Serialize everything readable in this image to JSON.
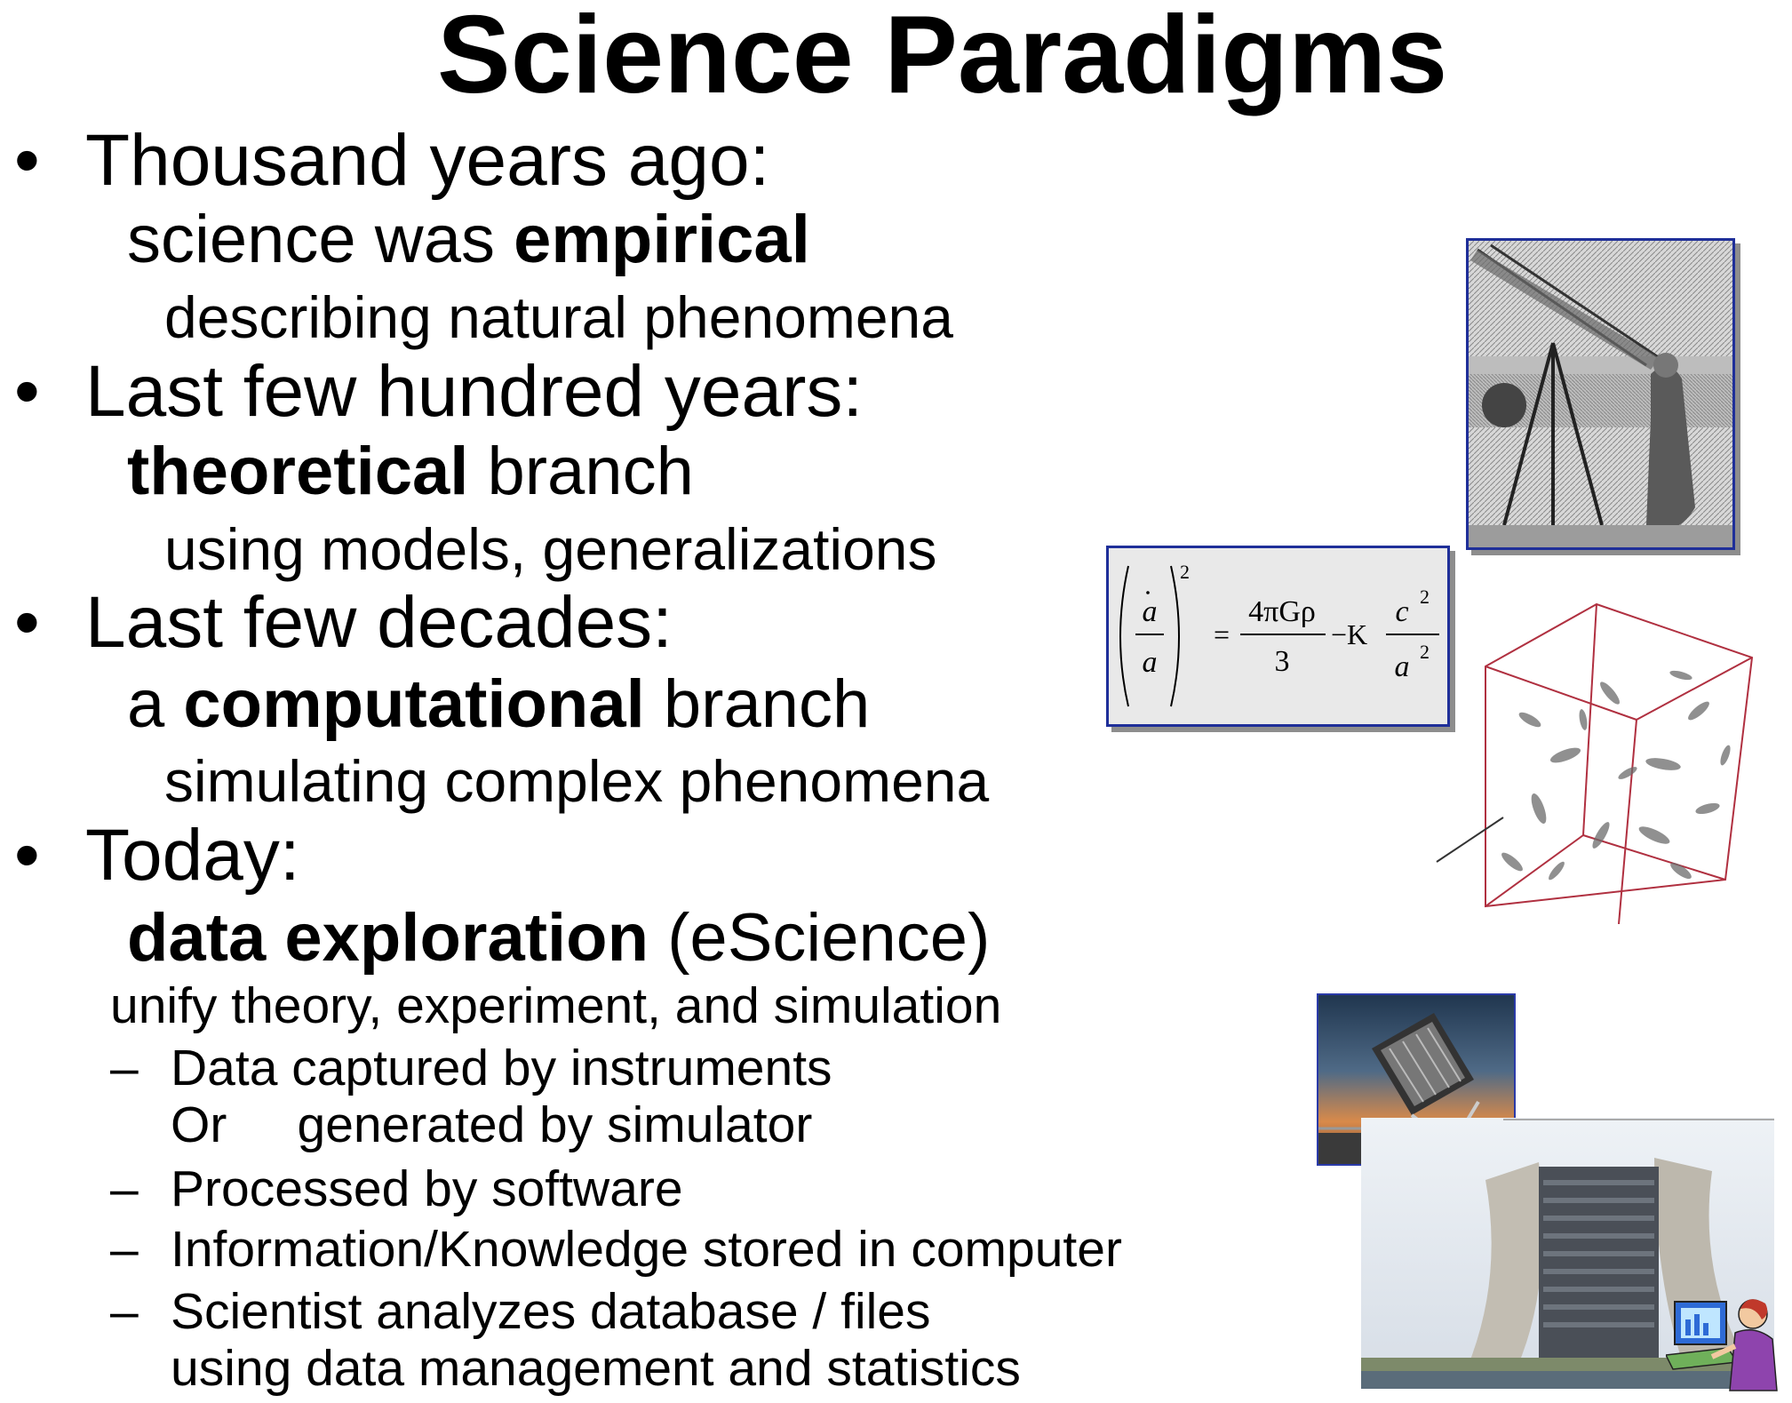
{
  "slide": {
    "title": "Science Paradigms",
    "bullet_char": "•",
    "dash_char": "–",
    "eras": [
      {
        "heading": "Thousand years ago:",
        "sub_pre": "science was ",
        "sub_bold": "empirical",
        "sub_post": "",
        "detail": "describing natural phenomena"
      },
      {
        "heading": "Last few hundred years:",
        "sub_pre": "",
        "sub_bold": "theoretical",
        "sub_post": " branch",
        "detail": "using models, generalizations"
      },
      {
        "heading": "Last few decades:",
        "sub_pre": "a ",
        "sub_bold": "computational",
        "sub_post": " branch",
        "detail": "simulating complex phenomena"
      }
    ],
    "today": {
      "heading": "Today:",
      "sub_bold": "data exploration",
      "sub_post": " (eScience)",
      "detail": "unify theory, experiment, and simulation",
      "items": [
        "Data captured by instruments",
        "Or     generated by simulator",
        "Processed by software",
        "Information/Knowledge stored in computer",
        "Scientist analyzes database / files",
        "using data management and statistics"
      ]
    }
  },
  "equation": {
    "lhs_num": "a",
    "lhs_den": "a",
    "exp": "2",
    "eq": "=",
    "frac_num": "4πGρ",
    "frac_den": "3",
    "minus_k": "−K",
    "c_num": "c",
    "a_den": "a",
    "sq": "2"
  },
  "images": {
    "telescope": "telescope-engraving-image",
    "simulation": "simulation-cube-image",
    "survey_telescope": "survey-telescope-image",
    "building": "lab-building-image",
    "scientist": "scientist-at-computer-icon"
  },
  "colors": {
    "frame": "#1f2f99",
    "equation_bg": "#e9e9e9",
    "cube_edge": "#b03040"
  }
}
